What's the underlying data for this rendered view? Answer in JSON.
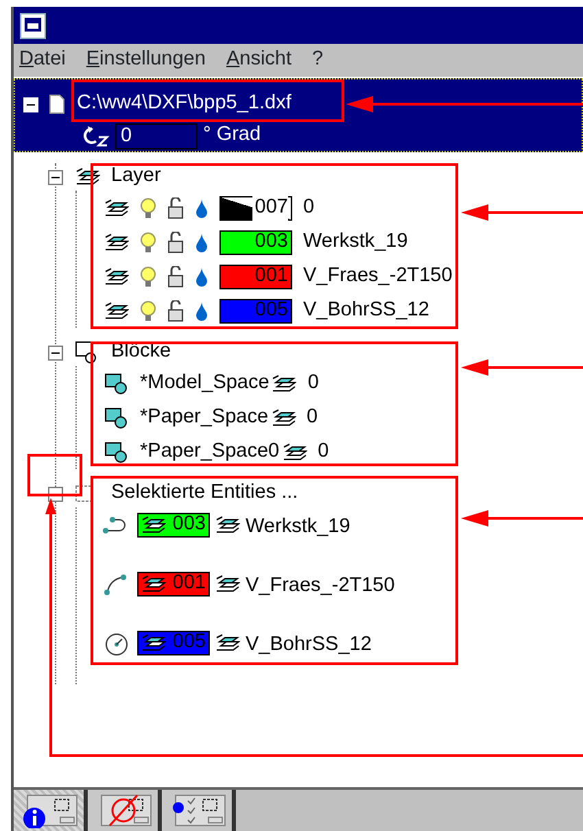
{
  "window": {
    "menu": [
      {
        "label": "Datei"
      },
      {
        "label": "Einstellungen"
      },
      {
        "label": "Ansicht"
      },
      {
        "label": "?"
      }
    ]
  },
  "tree": {
    "label": "C:\\ww4\\DXF\\bpp5_1.dxf",
    "expanded": true,
    "selected": true,
    "rotation": {
      "value": "0",
      "unit": "° Grad"
    },
    "groups": [
      {
        "kind": "layers",
        "label": "Layer",
        "expanded": true,
        "children": [
          {
            "name": "0",
            "number": "007",
            "color": "#ffffff",
            "on": true,
            "locked": false
          },
          {
            "name": "Werkstk_19",
            "number": "003",
            "color": "#00ff00",
            "on": true,
            "locked": false
          },
          {
            "name": "V_Fraes_-2T150",
            "number": "001",
            "color": "#ff0000",
            "on": true,
            "locked": false
          },
          {
            "name": "V_BohrSS_12",
            "number": "005",
            "color": "#0000ff",
            "on": true,
            "locked": false
          }
        ]
      },
      {
        "kind": "blocks",
        "label": "Blöcke",
        "expanded": true,
        "children": [
          {
            "name": "*Model_Space",
            "layer": "0"
          },
          {
            "name": "*Paper_Space",
            "layer": "0"
          },
          {
            "name": "*Paper_Space0",
            "layer": "0"
          }
        ]
      },
      {
        "kind": "entities",
        "label": "Selektierte Entities ...",
        "expanded": true,
        "children": [
          {
            "kind": "polyline",
            "number": "003",
            "color": "#00ff00",
            "layer": "Werkstk_19"
          },
          {
            "kind": "arc",
            "number": "001",
            "color": "#ff0000",
            "layer": "V_Fraes_-2T150"
          },
          {
            "kind": "circle",
            "number": "005",
            "color": "#0000ff",
            "layer": "V_BohrSS_12"
          }
        ]
      }
    ]
  },
  "toolbar": [
    {
      "kind": "info",
      "selected": true
    },
    {
      "kind": "none",
      "selected": false
    },
    {
      "kind": "checklist",
      "selected": false
    }
  ]
}
